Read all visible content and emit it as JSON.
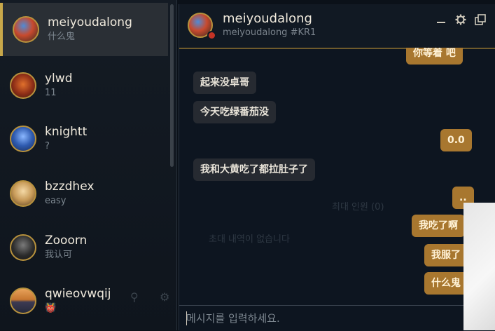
{
  "sidebar": {
    "friends": [
      {
        "name": "meiyoudalong",
        "status": "什么鬼",
        "active": true
      },
      {
        "name": "ylwd",
        "status": "11",
        "active": false
      },
      {
        "name": "knightt",
        "status": "?",
        "active": false
      },
      {
        "name": "bzzdhex",
        "status": "easy",
        "active": false
      },
      {
        "name": "Zooorn",
        "status": "我认可",
        "active": false
      },
      {
        "name": "qwieovwqij",
        "status": "👹",
        "active": false
      }
    ]
  },
  "chat": {
    "header": {
      "name": "meiyoudalong",
      "tag": "meiyoudalong #KR1",
      "minimize_icon": "minimize-icon",
      "settings_icon": "gear-icon",
      "popout_icon": "popout-icon"
    },
    "messages": [
      {
        "text": "你等着 吧",
        "from": "self"
      },
      {
        "text": "起来没卓哥",
        "from": "friend"
      },
      {
        "text": "今天吃绿番茄没",
        "from": "friend"
      },
      {
        "text": "0.0",
        "from": "self"
      },
      {
        "text": "我和大黄吃了都拉肚子了",
        "from": "friend"
      },
      {
        "text": "..",
        "from": "self"
      },
      {
        "text": "我吃了啊",
        "from": "self"
      },
      {
        "text": "我服了",
        "from": "self"
      },
      {
        "text": "什么鬼",
        "from": "self"
      }
    ],
    "background_text": [
      "최대 인원 (0)",
      "초대 내역이 없습니다"
    ],
    "input": {
      "placeholder": "메시지를 입력하세요."
    }
  }
}
